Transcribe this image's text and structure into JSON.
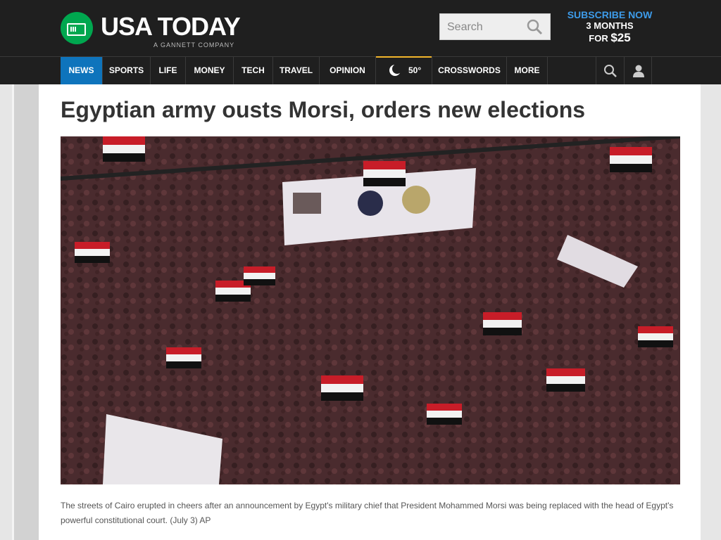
{
  "brand": {
    "name": "USA TODAY",
    "sub": "A GANNETT COMPANY",
    "color": "#00a74f"
  },
  "search": {
    "placeholder": "Search"
  },
  "subscribe": {
    "line1": "SUBSCRIBE NOW",
    "line2": "3 MONTHS",
    "line3_prefix": "FOR ",
    "line3_price": "$25"
  },
  "nav": {
    "items": [
      "NEWS",
      "SPORTS",
      "LIFE",
      "MONEY",
      "TECH",
      "TRAVEL",
      "OPINION",
      "50°",
      "CROSSWORDS",
      "MORE"
    ],
    "active": "NEWS",
    "icons": [
      "weather-icon",
      "search-icon",
      "user-icon"
    ]
  },
  "article": {
    "headline": "Egyptian army ousts Morsi, orders new elections",
    "caption": "The streets of Cairo erupted in cheers after an announcement by Egypt's military chief that President Mohammed Morsi was being replaced with the head of Egypt's powerful constitutional court. (July 3) AP"
  },
  "colors": {
    "header": "#1f1f1f",
    "accent": "#0e74bc",
    "subscribe": "#3d9be9"
  }
}
